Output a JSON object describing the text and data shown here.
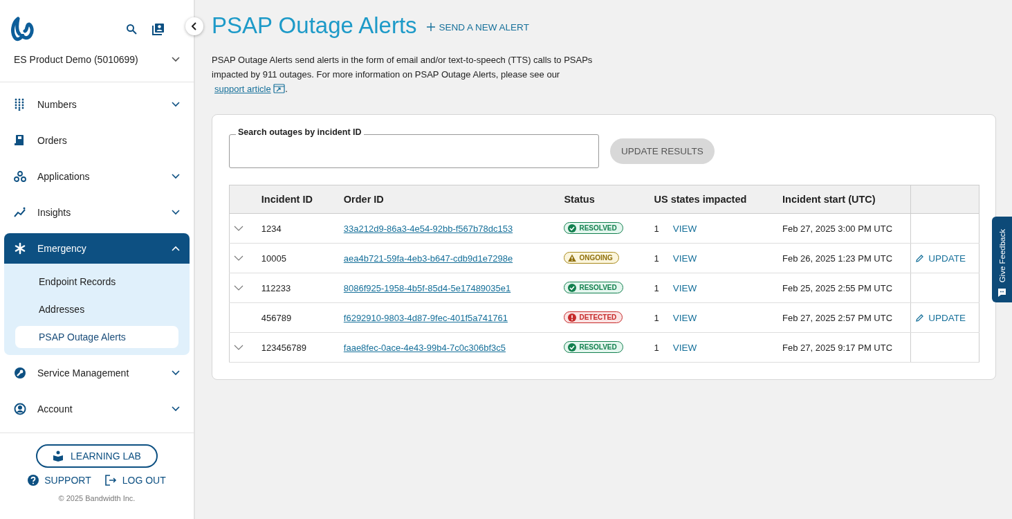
{
  "sidebar": {
    "account": "ES Product Demo (5010699)",
    "nav": [
      {
        "label": "Numbers",
        "expandable": true,
        "expanded": false
      },
      {
        "label": "Orders",
        "expandable": false,
        "expanded": false
      },
      {
        "label": "Applications",
        "expandable": true,
        "expanded": false
      },
      {
        "label": "Insights",
        "expandable": true,
        "expanded": false
      },
      {
        "label": "Emergency",
        "expandable": true,
        "expanded": true,
        "children": [
          {
            "label": "Endpoint Records",
            "selected": false
          },
          {
            "label": "Addresses",
            "selected": false
          },
          {
            "label": "PSAP Outage Alerts",
            "selected": true
          }
        ]
      },
      {
        "label": "Service Management",
        "expandable": true,
        "expanded": false
      },
      {
        "label": "Account",
        "expandable": true,
        "expanded": false
      }
    ],
    "learning_lab": "LEARNING LAB",
    "support": "SUPPORT",
    "logout": "LOG OUT",
    "copyright": "© 2025 Bandwidth Inc."
  },
  "page": {
    "title": "PSAP Outage Alerts",
    "new_alert": "SEND A NEW ALERT",
    "intro": "PSAP Outage Alerts send alerts in the form of email and/or text-to-speech (TTS) calls to PSAPs impacted by 911 outages. For more information on PSAP Outage Alerts, please see our",
    "intro_link": "support article",
    "intro_end": ".",
    "search": {
      "label": "Search outages by incident ID"
    },
    "update_results": {
      "label": "UPDATE RESULTS",
      "disabled": true
    }
  },
  "table": {
    "columns": [
      "Incident ID",
      "Order ID",
      "Status",
      "US states impacted",
      "Incident start (UTC)"
    ],
    "rows": [
      {
        "expandable": true,
        "incident_id": "1234",
        "order_id": "33a212d9-86a3-4e54-92bb-f567b78dc153",
        "status": {
          "kind": "resolved",
          "label": "RESOLVED"
        },
        "states": "1",
        "view": "VIEW",
        "start": "Feb 27, 2025 3:00 PM UTC"
      },
      {
        "expandable": true,
        "incident_id": "10005",
        "order_id": "aea4b721-59fa-4eb3-b647-cdb9d1e7298e",
        "status": {
          "kind": "ongoing",
          "label": "ONGOING"
        },
        "states": "1",
        "view": "VIEW",
        "start": "Feb 26, 2025 1:23 PM UTC",
        "action": "UPDATE"
      },
      {
        "expandable": true,
        "incident_id": "112233",
        "order_id": "8086f925-1958-4b5f-85d4-5e17489035e1",
        "status": {
          "kind": "resolved",
          "label": "RESOLVED"
        },
        "states": "1",
        "view": "VIEW",
        "start": "Feb 25, 2025 2:55 PM UTC"
      },
      {
        "expandable": false,
        "incident_id": "456789",
        "order_id": "f6292910-9803-4d87-9fec-401f5a741761",
        "status": {
          "kind": "detected",
          "label": "DETECTED"
        },
        "states": "1",
        "view": "VIEW",
        "start": "Feb 27, 2025 2:57 PM UTC",
        "action": "UPDATE"
      },
      {
        "expandable": true,
        "incident_id": "123456789",
        "order_id": "faae8fec-0ace-4e43-99b4-7c0c306bf3c5",
        "status": {
          "kind": "resolved",
          "label": "RESOLVED"
        },
        "states": "1",
        "view": "VIEW",
        "start": "Feb 27, 2025 9:17 PM UTC"
      }
    ]
  },
  "feedback": "Give Feedback"
}
